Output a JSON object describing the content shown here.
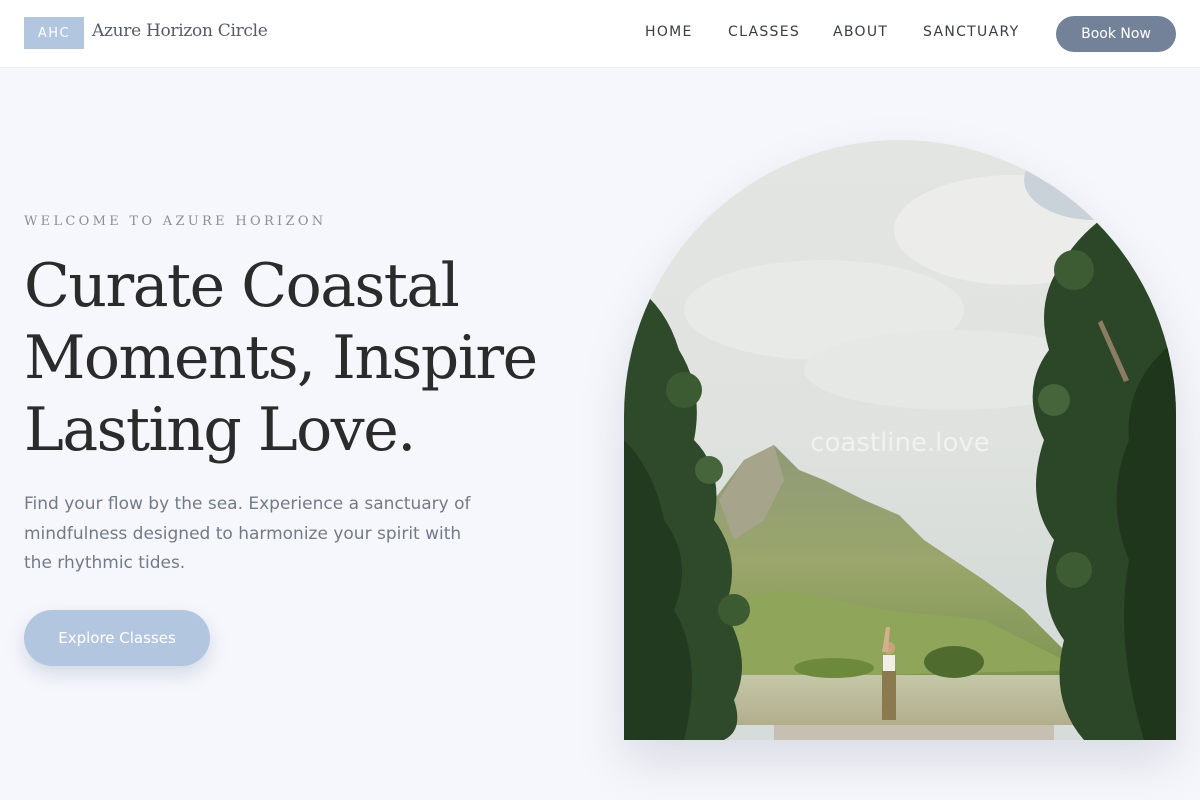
{
  "brand": {
    "badge": "AHC",
    "name": "Azure Horizon Circle"
  },
  "nav": {
    "items": [
      {
        "label": "HOME"
      },
      {
        "label": "CLASSES"
      },
      {
        "label": "ABOUT"
      },
      {
        "label": "SANCTUARY"
      }
    ],
    "cta_label": "Book Now"
  },
  "hero": {
    "eyebrow": "WELCOME TO AZURE HORIZON",
    "title_lines": [
      "Curate Coastal",
      "Moments, Inspire",
      "Lasting Love."
    ],
    "description": "Find your flow by the sea. Experience a sanctuary of mindfulness designed to harmonize your spirit with the rhythmic tides.",
    "cta_label": "Explore Classes"
  },
  "image": {
    "watermark": "coastline.love"
  },
  "colors": {
    "accent": "#b3c6df",
    "cta_dark": "#738299",
    "background": "#f6f7fc"
  }
}
